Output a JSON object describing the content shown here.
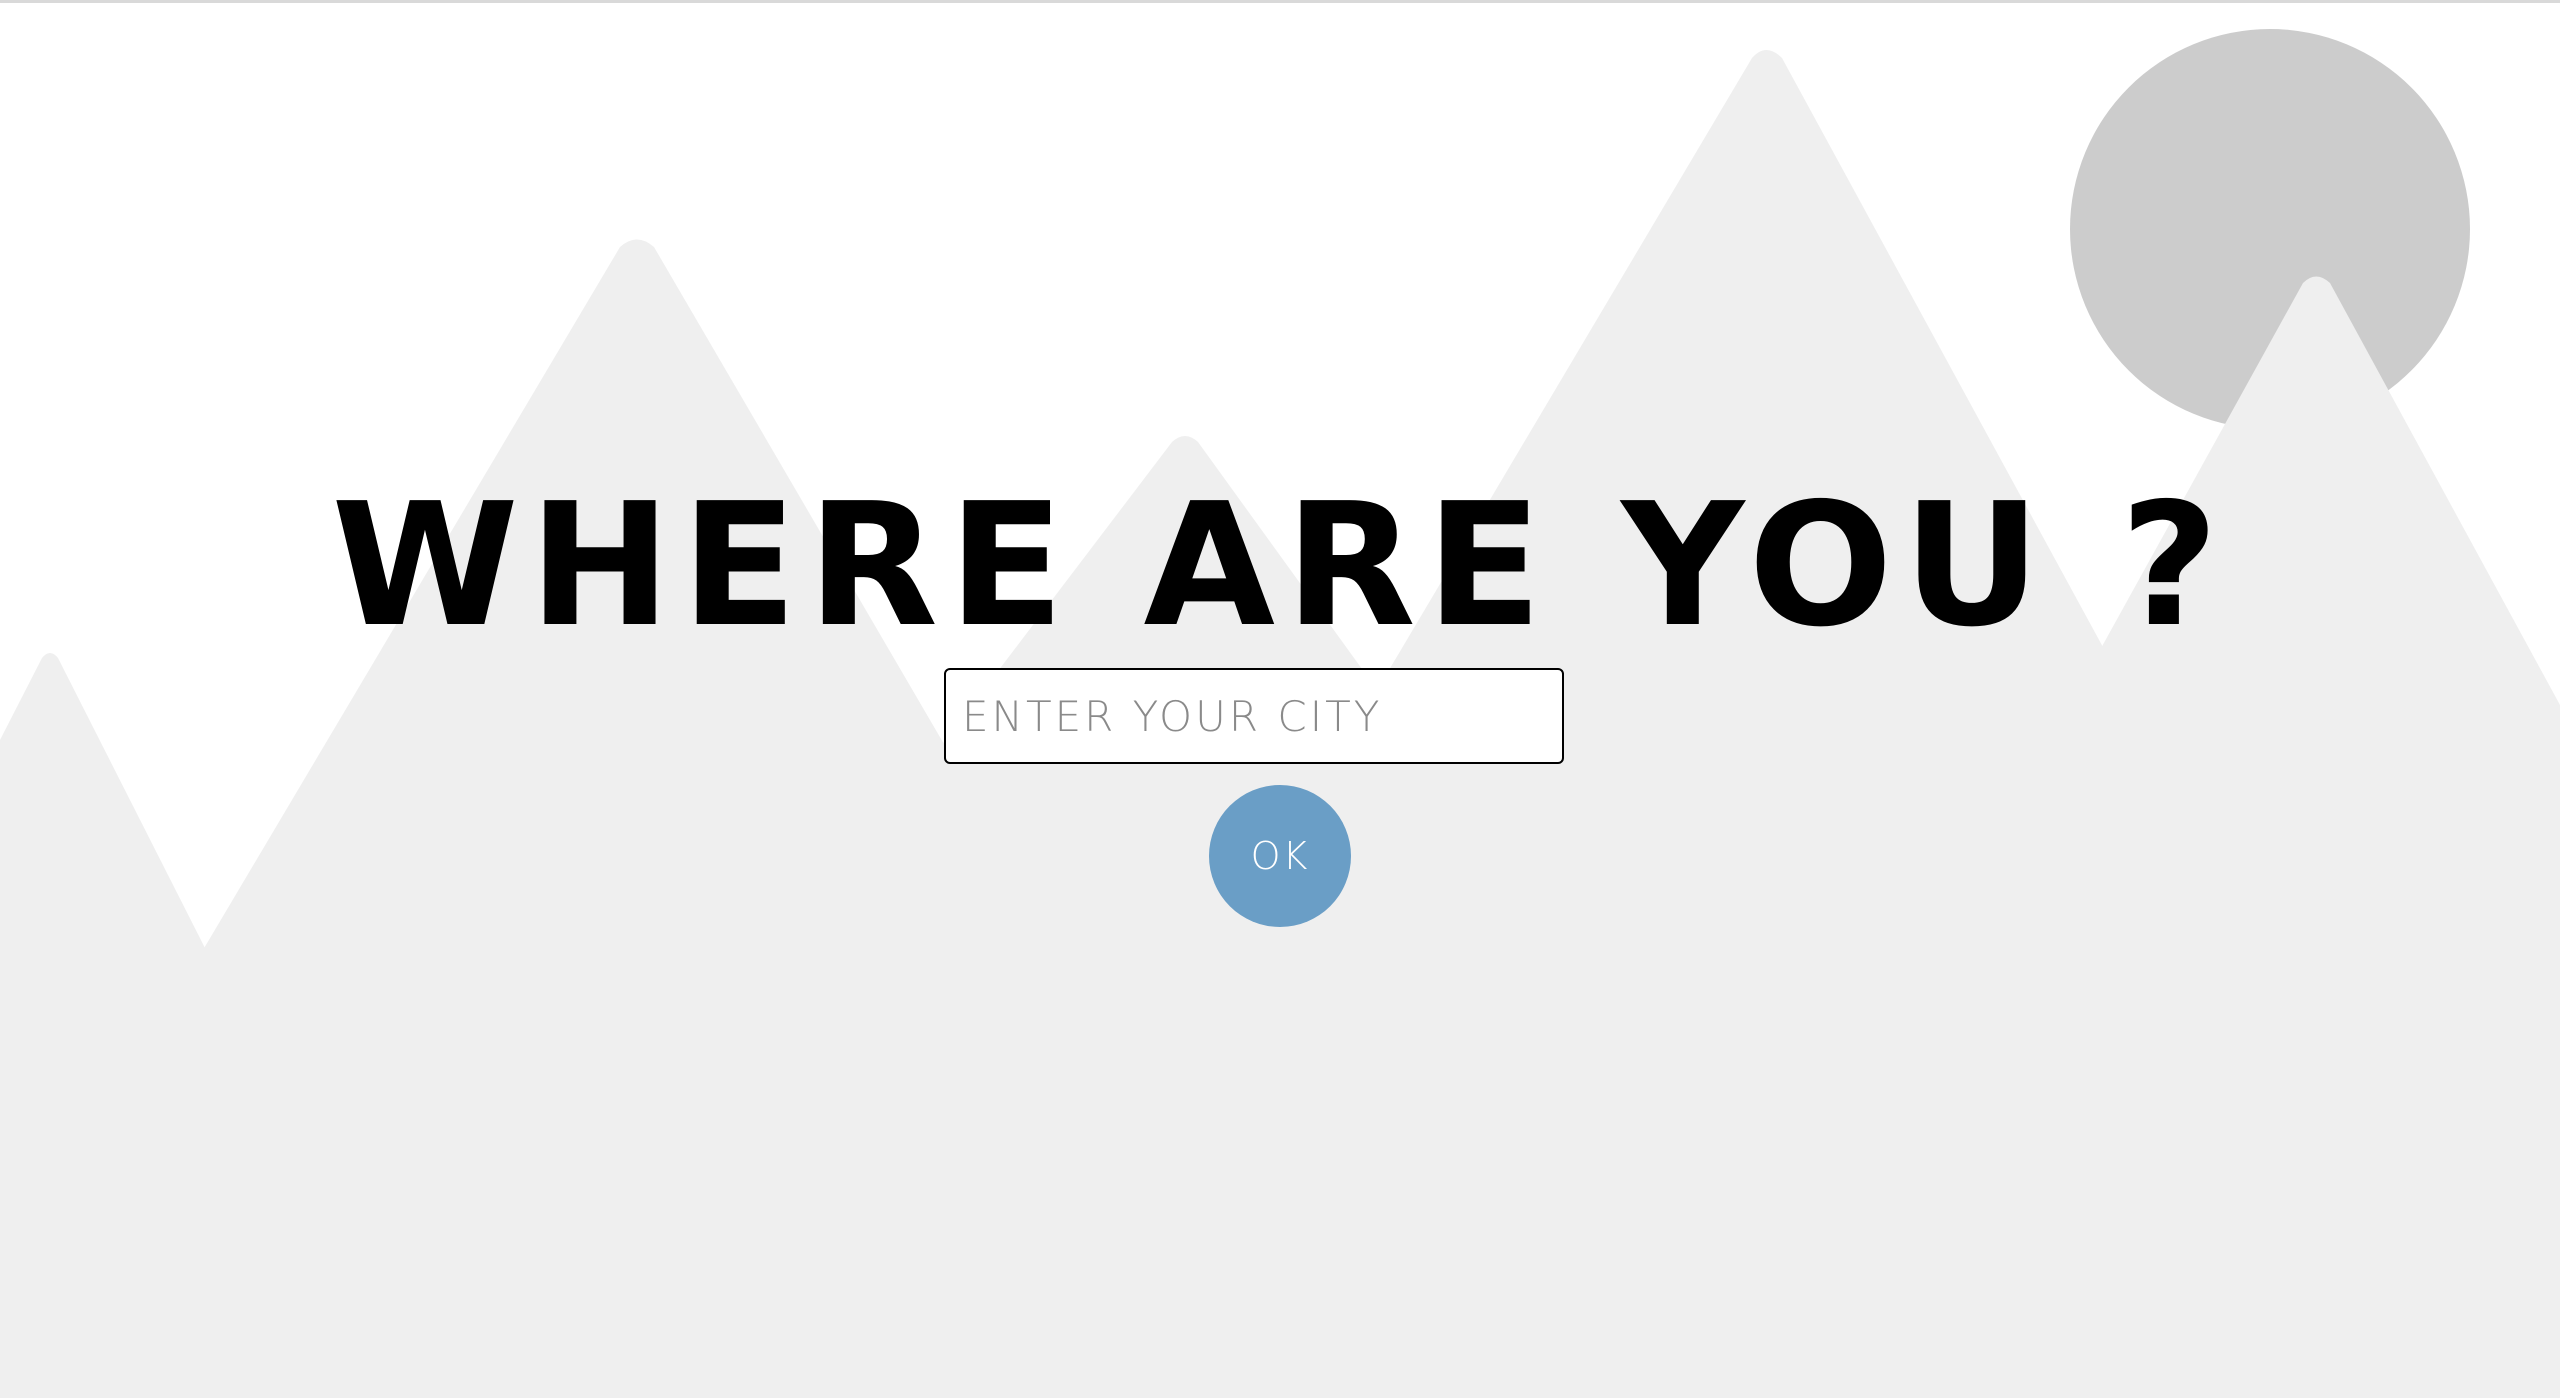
{
  "heading": {
    "text": "WHERE ARE YOU ?"
  },
  "city_input": {
    "placeholder": "ENTER YOUR CITY",
    "value": ""
  },
  "ok_button": {
    "label": "OK"
  },
  "colors": {
    "background": "#ffffff",
    "mountains": "#efefef",
    "sun": "#cccccc",
    "button": "#6a9ec6",
    "heading": "#000000"
  },
  "icons": {
    "sun": "sun-icon",
    "mountains": "mountain-icon"
  }
}
